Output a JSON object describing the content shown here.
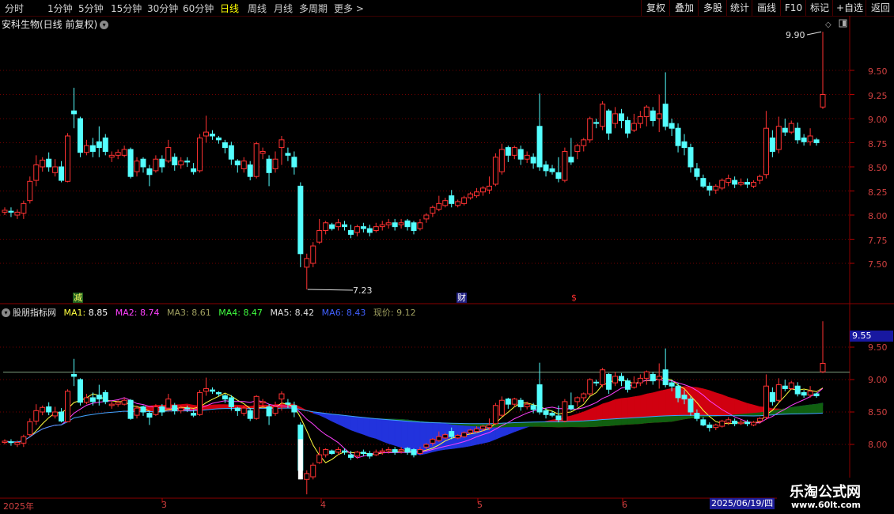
{
  "toolbar": {
    "periods": [
      "分时",
      "1分钟",
      "5分钟",
      "15分钟",
      "30分钟",
      "60分钟",
      "日线",
      "周线",
      "月线",
      "多周期",
      "更多 >"
    ],
    "active_period": "日线",
    "right_buttons": [
      "复权",
      "叠加",
      "多股",
      "统计",
      "画线",
      "F10",
      "标记",
      "+自选",
      "返回"
    ]
  },
  "main_chart": {
    "title": "安科生物(日线 前复权)",
    "y_ticks": [
      "9.50",
      "9.25",
      "9.00",
      "8.75",
      "8.50",
      "8.25",
      "8.00",
      "7.75",
      "7.50"
    ],
    "high_label": "9.90",
    "low_label": "7.23",
    "markers": [
      "减",
      "财",
      "$"
    ]
  },
  "indicator": {
    "name": "股朋指标网",
    "items": [
      {
        "label": "MA1:",
        "value": "8.85",
        "color": "#ffff40"
      },
      {
        "label": "MA2:",
        "value": "8.74",
        "color": "#ff40ff"
      },
      {
        "label": "MA3:",
        "value": "8.61",
        "color": "#a0a060"
      },
      {
        "label": "MA4:",
        "value": "8.47",
        "color": "#40ff40"
      },
      {
        "label": "MA5:",
        "value": "8.42",
        "color": "#e0e0e0"
      },
      {
        "label": "MA6:",
        "value": "8.43",
        "color": "#4060ff"
      },
      {
        "label": "现价:",
        "value": "9.12",
        "color": "#a0a060"
      }
    ],
    "y_ticks": [
      "9.50",
      "9.00",
      "8.50",
      "8.00"
    ],
    "current_price_box": "9.55"
  },
  "x_axis": {
    "labels": [
      "2025年",
      "3",
      "4",
      "5",
      "6"
    ],
    "cursor_date": "2025/06/19/四"
  },
  "watermark": {
    "site_name": "乐淘公式网",
    "url": "www.60lt.com"
  },
  "chart_data": {
    "type": "candlestick",
    "price_range": [
      7.23,
      9.9
    ],
    "high": 9.9,
    "low": 7.23,
    "last_close": 9.12,
    "candles": [
      [
        8.03,
        8.05,
        8.0,
        8.08
      ],
      [
        8.04,
        8.03,
        7.98,
        8.08
      ],
      [
        8.0,
        8.03,
        7.96,
        8.06
      ],
      [
        8.02,
        8.12,
        7.96,
        8.15
      ],
      [
        8.15,
        8.35,
        8.12,
        8.4
      ],
      [
        8.36,
        8.52,
        8.3,
        8.62
      ],
      [
        8.5,
        8.57,
        8.45,
        8.6
      ],
      [
        8.58,
        8.5,
        8.45,
        8.65
      ],
      [
        8.44,
        8.5,
        8.4,
        8.58
      ],
      [
        8.5,
        8.36,
        8.34,
        8.56
      ],
      [
        8.35,
        8.82,
        8.34,
        8.85
      ],
      [
        9.08,
        9.05,
        8.9,
        9.32
      ],
      [
        9.0,
        8.65,
        8.6,
        9.02
      ],
      [
        8.65,
        8.72,
        8.62,
        8.78
      ],
      [
        8.72,
        8.66,
        8.6,
        8.8
      ],
      [
        8.76,
        8.7,
        8.6,
        8.92
      ],
      [
        8.8,
        8.66,
        8.62,
        8.84
      ],
      [
        8.6,
        8.62,
        8.55,
        8.66
      ],
      [
        8.62,
        8.65,
        8.58,
        8.68
      ],
      [
        8.62,
        8.68,
        8.6,
        8.72
      ],
      [
        8.68,
        8.4,
        8.38,
        8.7
      ],
      [
        8.45,
        8.56,
        8.4,
        8.6
      ],
      [
        8.58,
        8.5,
        8.44,
        8.6
      ],
      [
        8.48,
        8.42,
        8.3,
        8.52
      ],
      [
        8.46,
        8.58,
        8.44,
        8.62
      ],
      [
        8.58,
        8.5,
        8.44,
        8.62
      ],
      [
        8.56,
        8.7,
        8.54,
        8.78
      ],
      [
        8.6,
        8.52,
        8.46,
        8.64
      ],
      [
        8.52,
        8.56,
        8.48,
        8.6
      ],
      [
        8.56,
        8.55,
        8.5,
        8.6
      ],
      [
        8.48,
        8.45,
        8.42,
        8.54
      ],
      [
        8.46,
        8.8,
        8.44,
        8.84
      ],
      [
        8.82,
        8.86,
        8.75,
        9.03
      ],
      [
        8.84,
        8.82,
        8.78,
        8.88
      ],
      [
        8.8,
        8.78,
        8.74,
        8.82
      ],
      [
        8.75,
        8.7,
        8.64,
        8.78
      ],
      [
        8.72,
        8.58,
        8.52,
        8.76
      ],
      [
        8.56,
        8.52,
        8.44,
        8.58
      ],
      [
        8.48,
        8.56,
        8.44,
        8.6
      ],
      [
        8.52,
        8.4,
        8.36,
        8.56
      ],
      [
        8.4,
        8.74,
        8.38,
        8.76
      ],
      [
        8.64,
        8.66,
        8.58,
        8.7
      ],
      [
        8.58,
        8.44,
        8.3,
        8.62
      ],
      [
        8.48,
        8.58,
        8.44,
        8.66
      ],
      [
        8.7,
        8.78,
        8.52,
        8.82
      ],
      [
        8.64,
        8.62,
        8.56,
        8.7
      ],
      [
        8.6,
        8.5,
        8.42,
        8.66
      ],
      [
        8.3,
        7.6,
        7.46,
        8.34
      ],
      [
        7.46,
        7.55,
        7.23,
        7.6
      ],
      [
        7.5,
        7.68,
        7.46,
        7.72
      ],
      [
        7.72,
        7.84,
        7.7,
        7.96
      ],
      [
        7.84,
        7.92,
        7.8,
        7.94
      ],
      [
        7.9,
        7.86,
        7.84,
        7.92
      ],
      [
        7.88,
        7.92,
        7.84,
        7.96
      ],
      [
        7.9,
        7.88,
        7.84,
        7.94
      ],
      [
        7.84,
        7.8,
        7.76,
        7.9
      ],
      [
        7.82,
        7.88,
        7.78,
        7.9
      ],
      [
        7.88,
        7.86,
        7.82,
        7.92
      ],
      [
        7.86,
        7.82,
        7.78,
        7.9
      ],
      [
        7.84,
        7.88,
        7.82,
        7.92
      ],
      [
        7.88,
        7.9,
        7.84,
        7.94
      ],
      [
        7.9,
        7.92,
        7.86,
        7.96
      ],
      [
        7.92,
        7.88,
        7.84,
        7.96
      ],
      [
        7.9,
        7.92,
        7.86,
        7.96
      ],
      [
        7.94,
        7.88,
        7.84,
        7.96
      ],
      [
        7.92,
        7.84,
        7.8,
        7.94
      ],
      [
        7.86,
        7.92,
        7.84,
        7.96
      ],
      [
        7.96,
        8.0,
        7.92,
        8.02
      ],
      [
        8.02,
        8.08,
        7.98,
        8.1
      ],
      [
        8.06,
        8.12,
        8.04,
        8.2
      ],
      [
        8.1,
        8.15,
        8.08,
        8.18
      ],
      [
        8.2,
        8.12,
        8.08,
        8.26
      ],
      [
        8.1,
        8.14,
        8.08,
        8.16
      ],
      [
        8.12,
        8.18,
        8.1,
        8.2
      ],
      [
        8.18,
        8.22,
        8.16,
        8.24
      ],
      [
        8.2,
        8.24,
        8.18,
        8.28
      ],
      [
        8.24,
        8.28,
        8.2,
        8.3
      ],
      [
        8.26,
        8.3,
        8.22,
        8.4
      ],
      [
        8.32,
        8.6,
        8.3,
        8.64
      ],
      [
        8.45,
        8.68,
        8.42,
        8.74
      ],
      [
        8.7,
        8.62,
        8.55,
        8.72
      ],
      [
        8.62,
        8.7,
        8.58,
        8.72
      ],
      [
        8.68,
        8.58,
        8.52,
        8.72
      ],
      [
        8.58,
        8.62,
        8.54,
        8.66
      ],
      [
        8.6,
        8.54,
        8.48,
        8.64
      ],
      [
        8.92,
        8.5,
        8.46,
        9.26
      ],
      [
        8.52,
        8.46,
        8.4,
        8.56
      ],
      [
        8.48,
        8.45,
        8.42,
        8.52
      ],
      [
        8.44,
        8.38,
        8.34,
        8.6
      ],
      [
        8.36,
        8.66,
        8.34,
        8.7
      ],
      [
        8.6,
        8.55,
        8.52,
        8.8
      ],
      [
        8.66,
        8.72,
        8.58,
        8.74
      ],
      [
        8.72,
        8.78,
        8.66,
        8.8
      ],
      [
        8.78,
        9.0,
        8.75,
        9.02
      ],
      [
        8.96,
        8.95,
        8.9,
        9.0
      ],
      [
        8.92,
        9.15,
        8.88,
        9.18
      ],
      [
        9.08,
        8.85,
        8.78,
        9.1
      ],
      [
        8.95,
        9.05,
        8.9,
        9.12
      ],
      [
        9.05,
        8.98,
        8.9,
        9.1
      ],
      [
        8.98,
        8.85,
        8.8,
        9.02
      ],
      [
        8.88,
        8.95,
        8.86,
        9.05
      ],
      [
        8.95,
        9.02,
        8.9,
        9.08
      ],
      [
        9.02,
        9.12,
        8.92,
        9.14
      ],
      [
        9.08,
        8.98,
        8.92,
        9.12
      ],
      [
        9.0,
        9.05,
        8.86,
        9.25
      ],
      [
        9.15,
        8.92,
        8.88,
        9.48
      ],
      [
        8.95,
        8.9,
        8.82,
        9.0
      ],
      [
        8.9,
        8.72,
        8.65,
        8.95
      ],
      [
        8.76,
        8.7,
        8.62,
        8.84
      ],
      [
        8.7,
        8.5,
        8.44,
        8.74
      ],
      [
        8.48,
        8.4,
        8.36,
        8.54
      ],
      [
        8.38,
        8.3,
        8.28,
        8.42
      ],
      [
        8.3,
        8.26,
        8.2,
        8.34
      ],
      [
        8.26,
        8.3,
        8.22,
        8.32
      ],
      [
        8.28,
        8.36,
        8.26,
        8.38
      ],
      [
        8.34,
        8.38,
        8.3,
        8.42
      ],
      [
        8.36,
        8.32,
        8.28,
        8.4
      ],
      [
        8.32,
        8.34,
        8.3,
        8.38
      ],
      [
        8.34,
        8.32,
        8.28,
        8.38
      ],
      [
        8.3,
        8.34,
        8.28,
        8.36
      ],
      [
        8.36,
        8.4,
        8.32,
        8.42
      ],
      [
        8.42,
        8.9,
        8.38,
        9.08
      ],
      [
        8.8,
        8.66,
        8.6,
        8.88
      ],
      [
        8.68,
        8.92,
        8.64,
        9.02
      ],
      [
        8.9,
        8.86,
        8.82,
        9.0
      ],
      [
        8.86,
        8.95,
        8.84,
        8.98
      ],
      [
        8.9,
        8.78,
        8.74,
        8.96
      ],
      [
        8.8,
        8.76,
        8.72,
        8.84
      ],
      [
        8.76,
        8.82,
        8.72,
        8.9
      ],
      [
        8.78,
        8.75,
        8.72,
        8.8
      ],
      [
        9.12,
        9.25,
        9.1,
        9.9
      ]
    ]
  }
}
